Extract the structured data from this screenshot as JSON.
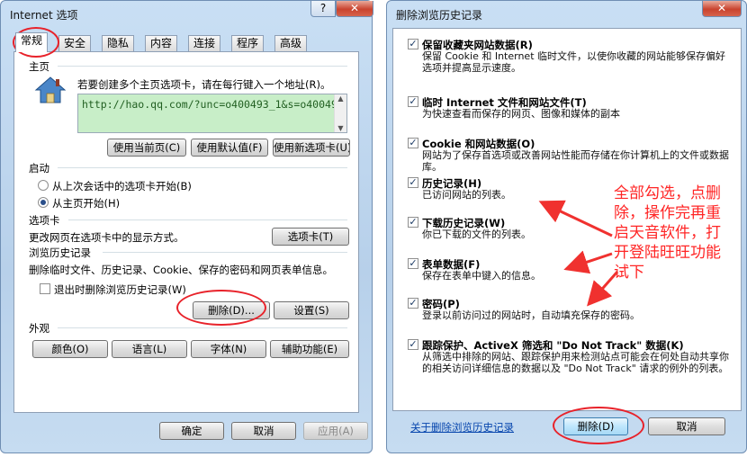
{
  "internet_options": {
    "title": "Internet 选项",
    "help_btn": "?",
    "close_btn": "✕",
    "tabs": [
      "常规",
      "安全",
      "隐私",
      "内容",
      "连接",
      "程序",
      "高级"
    ],
    "home": {
      "group": "主页",
      "desc": "若要创建多个主页选项卡，请在每行键入一个地址(R)。",
      "url": "http://hao.qq.com/?unc=o400493_1&s=o40049",
      "btn_current": "使用当前页(C)",
      "btn_default": "使用默认值(F)",
      "btn_new_tab": "使用新选项卡(U)"
    },
    "startup": {
      "group": "启动",
      "opt_last": "从上次会话中的选项卡开始(B)",
      "opt_home": "从主页开始(H)"
    },
    "tabs_group": {
      "group": "选项卡",
      "desc": "更改网页在选项卡中的显示方式。",
      "btn": "选项卡(T)"
    },
    "history": {
      "group": "浏览历史记录",
      "desc": "删除临时文件、历史记录、Cookie、保存的密码和网页表单信息。",
      "chk_exit": "退出时删除浏览历史记录(W)",
      "btn_delete": "删除(D)...",
      "btn_settings": "设置(S)"
    },
    "appearance": {
      "group": "外观",
      "btn_colors": "颜色(O)",
      "btn_languages": "语言(L)",
      "btn_fonts": "字体(N)",
      "btn_accessibility": "辅助功能(E)"
    },
    "footer": {
      "ok": "确定",
      "cancel": "取消",
      "apply": "应用(A)"
    }
  },
  "delete_history": {
    "title": "删除浏览历史记录",
    "close_btn": "✕",
    "items": [
      {
        "label": "保留收藏夹网站数据(R)",
        "desc": "保留 Cookie 和 Internet 临时文件，以使你收藏的网站能够保存偏好选项并提高显示速度。"
      },
      {
        "label": "临时 Internet 文件和网站文件(T)",
        "desc": "为快速查看而保存的网页、图像和媒体的副本"
      },
      {
        "label": "Cookie 和网站数据(O)",
        "desc": "网站为了保存首选项或改善网站性能而存储在你计算机上的文件或数据库。"
      },
      {
        "label": "历史记录(H)",
        "desc": "已访问网站的列表。"
      },
      {
        "label": "下载历史记录(W)",
        "desc": "你已下载的文件的列表。"
      },
      {
        "label": "表单数据(F)",
        "desc": "保存在表单中键入的信息。"
      },
      {
        "label": "密码(P)",
        "desc": "登录以前访问过的网站时，自动填充保存的密码。"
      },
      {
        "label": "跟踪保护、ActiveX 筛选和 \"Do Not Track\" 数据(K)",
        "desc": "从筛选中排除的网站、跟踪保护用来检测站点可能会在何处自动共享你的相关访问详细信息的数据以及 \"Do Not Track\" 请求的例外的列表。"
      }
    ],
    "about_link": "关于删除浏览历史记录",
    "btn_delete": "删除(D)",
    "btn_cancel": "取消"
  },
  "annotation": {
    "lines": [
      "全部勾选，点删",
      "除，操作完再重",
      "启天音软件，打",
      "开登陆旺旺功能",
      "试下"
    ],
    "color": "#ff2525"
  }
}
